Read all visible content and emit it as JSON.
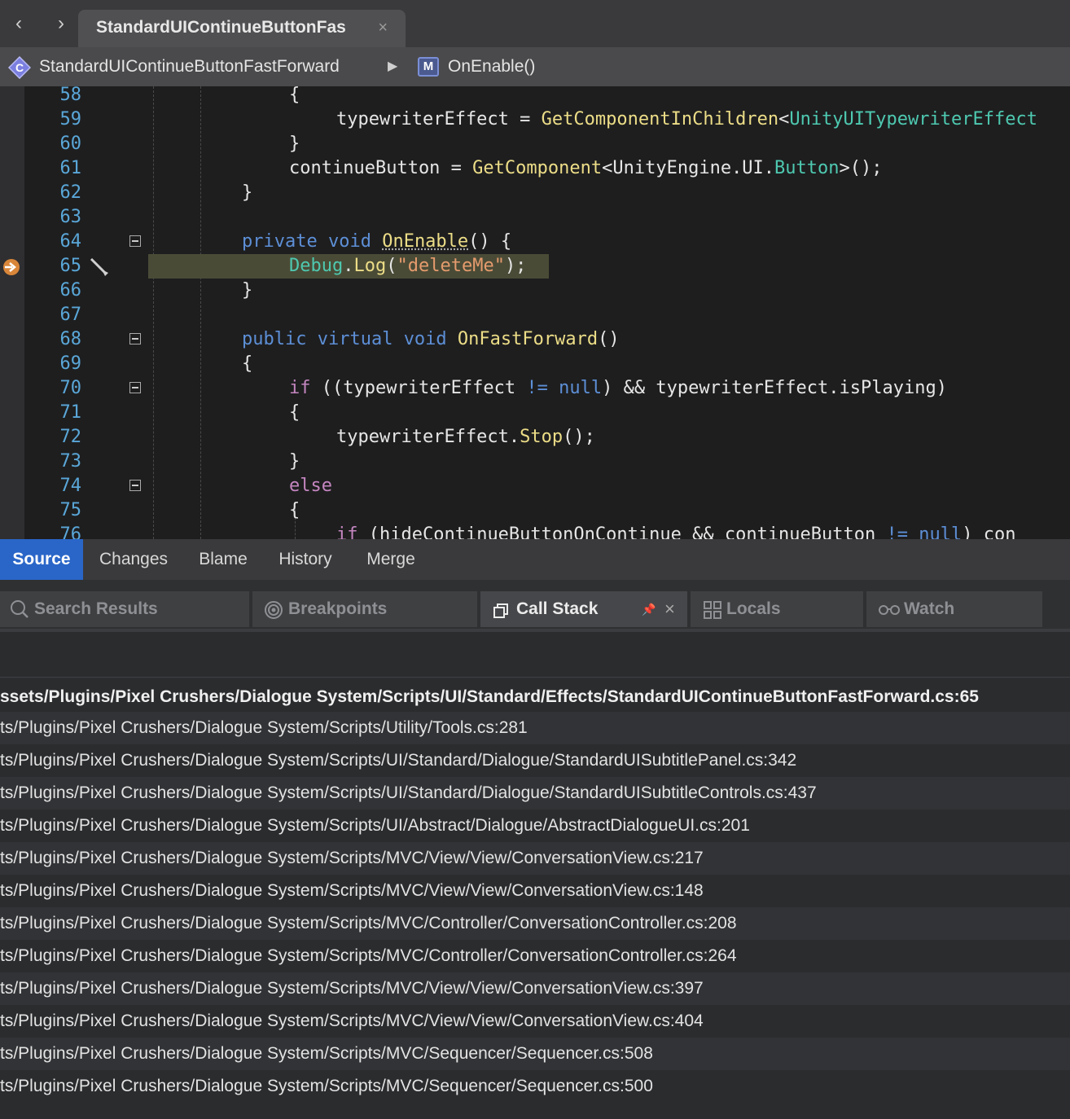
{
  "tab": {
    "title": "StandardUIContinueButtonFas",
    "close": "×"
  },
  "nav": {
    "back": "‹",
    "forward": "›"
  },
  "path": {
    "class_name": "StandardUIContinueButtonFastForward",
    "arrow": "▶",
    "method_badge": "M",
    "method": "OnEnable()"
  },
  "editor": {
    "lines": [
      {
        "n": "58",
        "segs": [
          {
            "t": "{",
            "c": ""
          }
        ]
      },
      {
        "n": "59",
        "segs": [
          {
            "t": "typewriterEffect = ",
            "c": ""
          },
          {
            "t": "GetComponentInChildren",
            "c": "fn"
          },
          {
            "t": "<",
            "c": ""
          },
          {
            "t": "UnityUITypewriterEffect",
            "c": "ty"
          }
        ]
      },
      {
        "n": "60",
        "segs": [
          {
            "t": "}",
            "c": ""
          }
        ]
      },
      {
        "n": "61",
        "segs": [
          {
            "t": "continueButton = ",
            "c": ""
          },
          {
            "t": "GetComponent",
            "c": "fn"
          },
          {
            "t": "<UnityEngine.UI.",
            "c": ""
          },
          {
            "t": "Button",
            "c": "ty"
          },
          {
            "t": ">();",
            "c": ""
          }
        ]
      },
      {
        "n": "62",
        "segs": [
          {
            "t": "}",
            "c": ""
          }
        ]
      },
      {
        "n": "63",
        "segs": []
      },
      {
        "n": "64",
        "segs": [
          {
            "t": "private ",
            "c": "kw"
          },
          {
            "t": "void ",
            "c": "kw"
          },
          {
            "t": "OnEnable",
            "c": "fn"
          },
          {
            "t": "() {",
            "c": ""
          }
        ]
      },
      {
        "n": "65",
        "segs": [
          {
            "t": "Debug",
            "c": "ty"
          },
          {
            "t": ".",
            "c": ""
          },
          {
            "t": "Log",
            "c": "fn"
          },
          {
            "t": "(",
            "c": ""
          },
          {
            "t": "\"deleteMe\"",
            "c": "str"
          },
          {
            "t": ");",
            "c": ""
          }
        ]
      },
      {
        "n": "66",
        "segs": [
          {
            "t": "}",
            "c": ""
          }
        ]
      },
      {
        "n": "67",
        "segs": []
      },
      {
        "n": "68",
        "segs": [
          {
            "t": "public ",
            "c": "kw"
          },
          {
            "t": "virtual ",
            "c": "kw"
          },
          {
            "t": "void ",
            "c": "kw"
          },
          {
            "t": "OnFastForward",
            "c": "fn"
          },
          {
            "t": "()",
            "c": ""
          }
        ]
      },
      {
        "n": "69",
        "segs": [
          {
            "t": "{",
            "c": ""
          }
        ]
      },
      {
        "n": "70",
        "segs": [
          {
            "t": "if",
            "c": "ctl"
          },
          {
            "t": " ((typewriterEffect ",
            "c": ""
          },
          {
            "t": "!=",
            "c": "kw"
          },
          {
            "t": " ",
            "c": ""
          },
          {
            "t": "null",
            "c": "kw"
          },
          {
            "t": ") && typewriterEffect.isPlaying)",
            "c": ""
          }
        ]
      },
      {
        "n": "71",
        "segs": [
          {
            "t": "{",
            "c": ""
          }
        ]
      },
      {
        "n": "72",
        "segs": [
          {
            "t": "typewriterEffect.",
            "c": ""
          },
          {
            "t": "Stop",
            "c": "fn"
          },
          {
            "t": "();",
            "c": ""
          }
        ]
      },
      {
        "n": "73",
        "segs": [
          {
            "t": "}",
            "c": ""
          }
        ]
      },
      {
        "n": "74",
        "segs": [
          {
            "t": "else",
            "c": "ctl"
          }
        ]
      },
      {
        "n": "75",
        "segs": [
          {
            "t": "{",
            "c": ""
          }
        ]
      },
      {
        "n": "76",
        "segs": [
          {
            "t": "if",
            "c": "ctl"
          },
          {
            "t": " (hideContinueButtonOnContinue && continueButton ",
            "c": ""
          },
          {
            "t": "!=",
            "c": "kw"
          },
          {
            "t": " ",
            "c": ""
          },
          {
            "t": "null",
            "c": "kw"
          },
          {
            "t": ") con",
            "c": ""
          }
        ]
      }
    ]
  },
  "source_tabs": [
    "Source",
    "Changes",
    "Blame",
    "History",
    "Merge"
  ],
  "pads": {
    "search": "Search Results",
    "breakpoints": "Breakpoints",
    "callstack": "Call Stack",
    "callstack_pin": "📌",
    "callstack_close": "×",
    "locals": "Locals",
    "watch": "Watch"
  },
  "call_stack": [
    "ssets/Plugins/Pixel Crushers/Dialogue System/Scripts/UI/Standard/Effects/StandardUIContinueButtonFastForward.cs:65",
    "ts/Plugins/Pixel Crushers/Dialogue System/Scripts/Utility/Tools.cs:281",
    "ts/Plugins/Pixel Crushers/Dialogue System/Scripts/UI/Standard/Dialogue/StandardUISubtitlePanel.cs:342",
    "ts/Plugins/Pixel Crushers/Dialogue System/Scripts/UI/Standard/Dialogue/StandardUISubtitleControls.cs:437",
    "ts/Plugins/Pixel Crushers/Dialogue System/Scripts/UI/Abstract/Dialogue/AbstractDialogueUI.cs:201",
    "ts/Plugins/Pixel Crushers/Dialogue System/Scripts/MVC/View/View/ConversationView.cs:217",
    "ts/Plugins/Pixel Crushers/Dialogue System/Scripts/MVC/View/View/ConversationView.cs:148",
    "ts/Plugins/Pixel Crushers/Dialogue System/Scripts/MVC/Controller/ConversationController.cs:208",
    "ts/Plugins/Pixel Crushers/Dialogue System/Scripts/MVC/Controller/ConversationController.cs:264",
    "ts/Plugins/Pixel Crushers/Dialogue System/Scripts/MVC/View/View/ConversationView.cs:397",
    "ts/Plugins/Pixel Crushers/Dialogue System/Scripts/MVC/View/View/ConversationView.cs:404",
    "ts/Plugins/Pixel Crushers/Dialogue System/Scripts/MVC/Sequencer/Sequencer.cs:508",
    "ts/Plugins/Pixel Crushers/Dialogue System/Scripts/MVC/Sequencer/Sequencer.cs:500"
  ],
  "colors": {
    "accent": "#2a66c8",
    "line_numbers": "#5aa7d8",
    "current_line": "#4a4b36",
    "keyword": "#5d8fd6",
    "method": "#ecdd87",
    "type": "#4ec9b0",
    "string": "#e59b6d"
  }
}
